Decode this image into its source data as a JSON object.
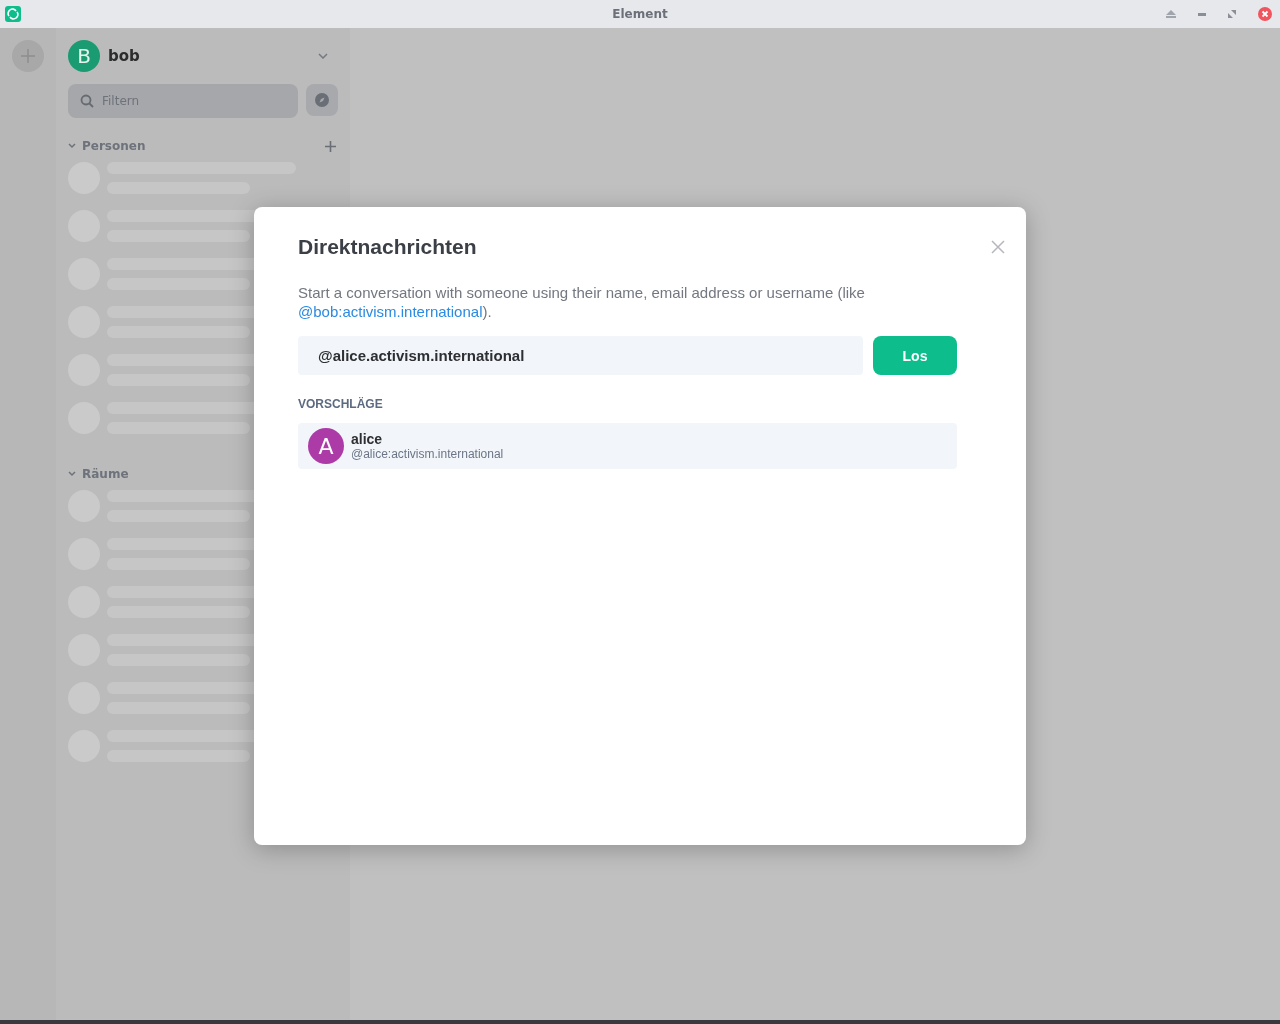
{
  "window": {
    "title": "Element"
  },
  "sidebar": {
    "account": {
      "initial": "B",
      "name": "bob"
    },
    "search": {
      "placeholder": "Filtern"
    },
    "sections": [
      {
        "label": "Personen",
        "expanded": true,
        "can_add": true
      },
      {
        "label": "Räume",
        "expanded": true,
        "can_add": false
      }
    ]
  },
  "dialog": {
    "title": "Direktnachrichten",
    "description": {
      "before": "Start a conversation with someone using their name, email address or username (like ",
      "link": "@bob:activism.international",
      "after": ")."
    },
    "input": {
      "value": "@alice.activism.international"
    },
    "go_button": "Los",
    "suggestions_heading": "VORSCHLÄGE",
    "suggestions": [
      {
        "initial": "A",
        "name": "alice",
        "user_id": "@alice:activism.international",
        "color": "#ac3ba8"
      }
    ]
  }
}
